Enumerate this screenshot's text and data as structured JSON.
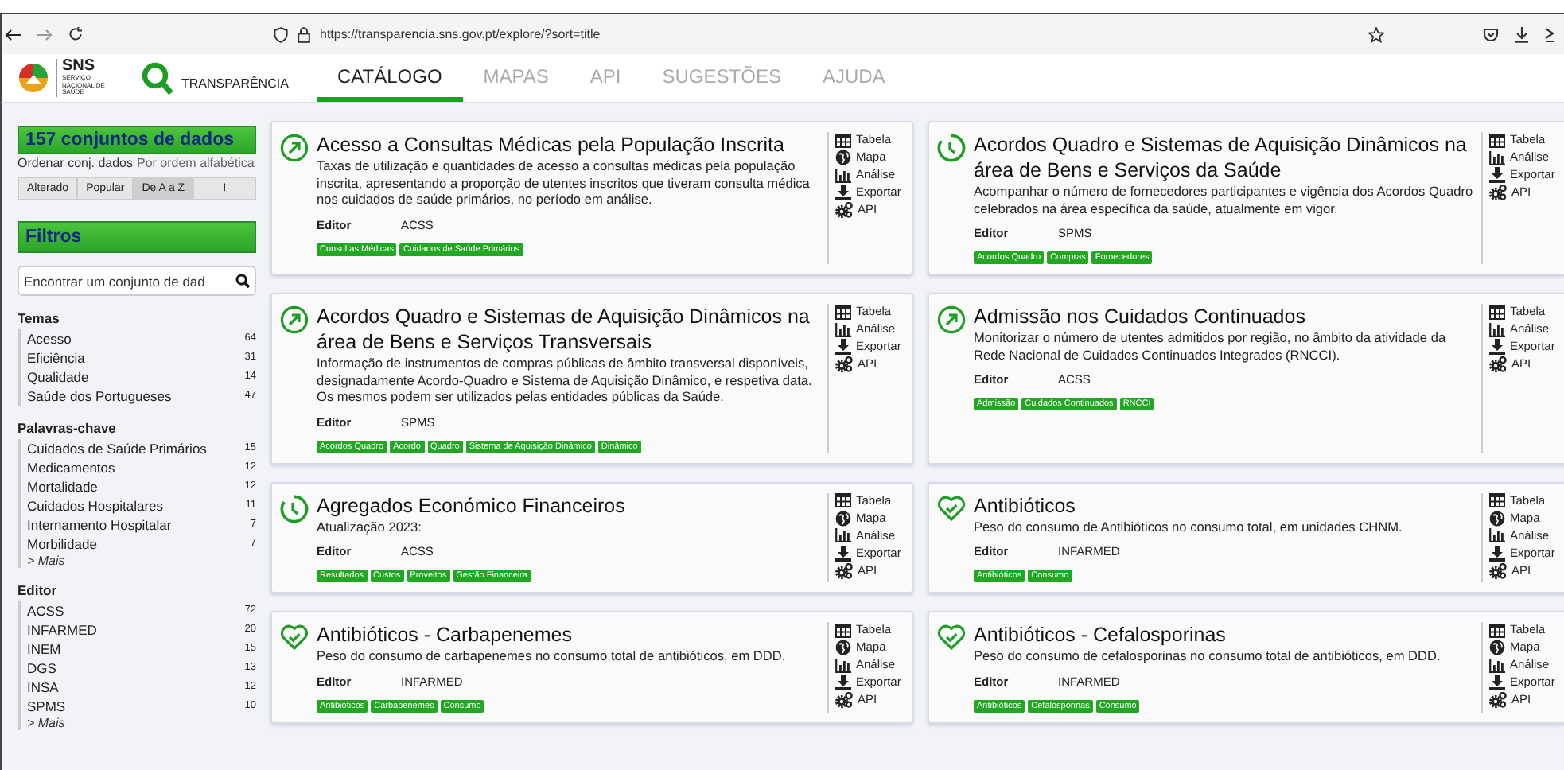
{
  "browser": {
    "url": "https://transparencia.sns.gov.pt/explore/?sort=title"
  },
  "header": {
    "logo_text": "SNS",
    "logo_subtext": "SERVIÇO NACIONAL DE SAÚDE",
    "brand": "TRANSPARÊNCIA",
    "nav": [
      {
        "label": "CATÁLOGO",
        "selected": true
      },
      {
        "label": "MAPAS",
        "selected": false
      },
      {
        "label": "API",
        "selected": false
      },
      {
        "label": "SUGESTÕES",
        "selected": false
      },
      {
        "label": "AJUDA",
        "selected": false
      }
    ]
  },
  "sidebar": {
    "count": "157 conjuntos de dados",
    "sort_label": "Ordenar conj. dados",
    "sort_value": "Por ordem alfabética",
    "sort_buttons": [
      {
        "label": "Alterado",
        "selected": false
      },
      {
        "label": "Popular",
        "selected": false
      },
      {
        "label": "De A a Z",
        "selected": true
      },
      {
        "label": "!",
        "selected": false
      }
    ],
    "filters_title": "Filtros",
    "search_placeholder": "Encontrar um conjunto de dad",
    "groups": [
      {
        "title": "Temas",
        "items": [
          {
            "label": "Acesso",
            "count": "64"
          },
          {
            "label": "Eficiência",
            "count": "31"
          },
          {
            "label": "Qualidade",
            "count": "14"
          },
          {
            "label": "Saúde dos Portugueses",
            "count": "47"
          }
        ]
      },
      {
        "title": "Palavras-chave",
        "items": [
          {
            "label": "Cuidados de Saúde Primários",
            "count": "15"
          },
          {
            "label": "Medicamentos",
            "count": "12"
          },
          {
            "label": "Mortalidade",
            "count": "12"
          },
          {
            "label": "Cuidados Hospitalares",
            "count": "11"
          },
          {
            "label": "Internamento Hospitalar",
            "count": "7"
          },
          {
            "label": "Morbilidade",
            "count": "7"
          }
        ],
        "more": "> Mais"
      },
      {
        "title": "Editor",
        "items": [
          {
            "label": "ACSS",
            "count": "72"
          },
          {
            "label": "INFARMED",
            "count": "20"
          },
          {
            "label": "INEM",
            "count": "15"
          },
          {
            "label": "DGS",
            "count": "13"
          },
          {
            "label": "INSA",
            "count": "12"
          },
          {
            "label": "SPMS",
            "count": "10"
          }
        ],
        "more": "> Mais"
      }
    ]
  },
  "datasets": [
    {
      "kind": "arrow",
      "title": "Acesso a Consultas Médicas pela População Inscrita",
      "description": "Taxas de utilização e quantidades de acesso a consultas médicas pela população inscrita, apresentando a proporção de utentes inscritos que tiveram consulta médica nos cuidados de saúde primários, no período em análise.",
      "editor_label": "Editor",
      "editor": "ACSS",
      "tags": [
        "Consultas Médicas",
        "Cuidados de Saúde Primários"
      ],
      "actions": [
        {
          "kind": "table",
          "label": "Tabela"
        },
        {
          "kind": "map",
          "label": "Mapa"
        },
        {
          "kind": "analysis",
          "label": "Análise"
        },
        {
          "kind": "export",
          "label": "Exportar"
        },
        {
          "kind": "api",
          "label": "API"
        }
      ]
    },
    {
      "kind": "clock",
      "title": "Acordos Quadro e Sistemas de Aquisição Dinâmicos na área de Bens e Serviços da Saúde",
      "description": "Acompanhar o número de fornecedores participantes e vigência dos Acordos Quadro celebrados na área específica da saúde, atualmente em vigor.",
      "editor_label": "Editor",
      "editor": "SPMS",
      "tags": [
        "Acordos Quadro",
        "Compras",
        "Fornecedores"
      ],
      "actions": [
        {
          "kind": "table",
          "label": "Tabela"
        },
        {
          "kind": "analysis",
          "label": "Análise"
        },
        {
          "kind": "export",
          "label": "Exportar"
        },
        {
          "kind": "api",
          "label": "API"
        }
      ]
    },
    {
      "kind": "arrow",
      "title": "Acordos Quadro e Sistemas de Aquisição Dinâmicos na área de Bens e Serviços Transversais",
      "description": "Informação de instrumentos de compras públicas de âmbito transversal disponíveis, designadamente Acordo-Quadro e Sistema de Aquisição Dinâmico, e respetiva data. Os mesmos podem ser utilizados pelas entidades públicas da Saúde.",
      "editor_label": "Editor",
      "editor": "SPMS",
      "tags": [
        "Acordos Quadro",
        "Acordo",
        "Quadro",
        "Sistema de Aquisição Dinâmico",
        "Dinâmico"
      ],
      "actions": [
        {
          "kind": "table",
          "label": "Tabela"
        },
        {
          "kind": "analysis",
          "label": "Análise"
        },
        {
          "kind": "export",
          "label": "Exportar"
        },
        {
          "kind": "api",
          "label": "API"
        }
      ]
    },
    {
      "kind": "arrow",
      "title": "Admissão nos Cuidados Continuados",
      "description": "Monitorizar o número de utentes admitidos por região, no âmbito da atividade da Rede Nacional de Cuidados Continuados Integrados (RNCCI).",
      "editor_label": "Editor",
      "editor": "ACSS",
      "tags": [
        "Admissão",
        "Cuidados Continuados",
        "RNCCI"
      ],
      "actions": [
        {
          "kind": "table",
          "label": "Tabela"
        },
        {
          "kind": "analysis",
          "label": "Análise"
        },
        {
          "kind": "export",
          "label": "Exportar"
        },
        {
          "kind": "api",
          "label": "API"
        }
      ]
    },
    {
      "kind": "clock",
      "title": "Agregados Económico Financeiros",
      "description": "Atualização 2023:",
      "editor_label": "Editor",
      "editor": "ACSS",
      "tags": [
        "Resultados",
        "Custos",
        "Proveitos",
        "Gestão Financeira"
      ],
      "actions": [
        {
          "kind": "table",
          "label": "Tabela"
        },
        {
          "kind": "map",
          "label": "Mapa"
        },
        {
          "kind": "analysis",
          "label": "Análise"
        },
        {
          "kind": "export",
          "label": "Exportar"
        },
        {
          "kind": "api",
          "label": "API"
        }
      ]
    },
    {
      "kind": "heart",
      "title": "Antibióticos",
      "description": "Peso do consumo de Antibióticos no consumo total, em unidades CHNM.",
      "editor_label": "Editor",
      "editor": "INFARMED",
      "tags": [
        "Antibióticos",
        "Consumo"
      ],
      "actions": [
        {
          "kind": "table",
          "label": "Tabela"
        },
        {
          "kind": "map",
          "label": "Mapa"
        },
        {
          "kind": "analysis",
          "label": "Análise"
        },
        {
          "kind": "export",
          "label": "Exportar"
        },
        {
          "kind": "api",
          "label": "API"
        }
      ]
    },
    {
      "kind": "heart",
      "title": "Antibióticos - Carbapenemes",
      "description": "Peso do consumo de carbapenemes no consumo total de antibióticos, em DDD.",
      "editor_label": "Editor",
      "editor": "INFARMED",
      "tags": [
        "Antibióticos",
        "Carbapenemes",
        "Consumo"
      ],
      "actions": [
        {
          "kind": "table",
          "label": "Tabela"
        },
        {
          "kind": "map",
          "label": "Mapa"
        },
        {
          "kind": "analysis",
          "label": "Análise"
        },
        {
          "kind": "export",
          "label": "Exportar"
        },
        {
          "kind": "api",
          "label": "API"
        }
      ]
    },
    {
      "kind": "heart",
      "title": "Antibióticos - Cefalosporinas",
      "description": "Peso do consumo de cefalosporinas no consumo total de antibióticos, em DDD.",
      "editor_label": "Editor",
      "editor": "INFARMED",
      "tags": [
        "Antibióticos",
        "Cefalosporinas",
        "Consumo"
      ],
      "actions": [
        {
          "kind": "table",
          "label": "Tabela"
        },
        {
          "kind": "map",
          "label": "Mapa"
        },
        {
          "kind": "analysis",
          "label": "Análise"
        },
        {
          "kind": "export",
          "label": "Exportar"
        },
        {
          "kind": "api",
          "label": "API"
        }
      ]
    }
  ]
}
